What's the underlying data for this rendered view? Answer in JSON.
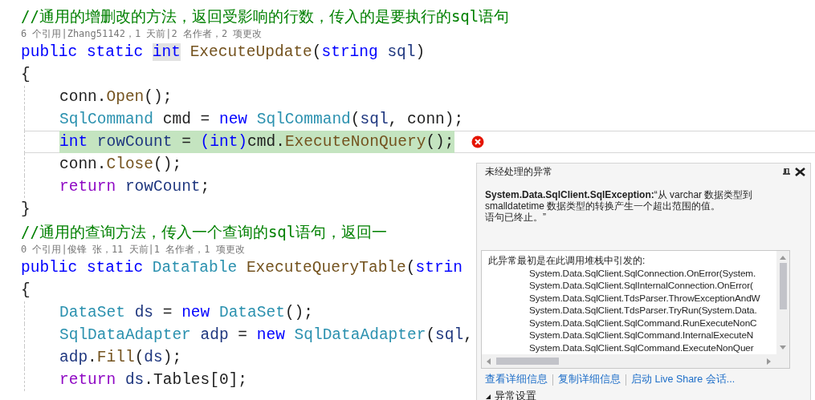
{
  "editor": {
    "lines": [
      {
        "kind": "comment",
        "text": "//通用的增删改的方法，返回受影响的行数，传入的是要执行的sql语句"
      },
      {
        "kind": "codelens",
        "text": "6 个引用|Zhang51142，1 天前|2 名作者，2 项更改"
      },
      {
        "kind": "code",
        "indented": false,
        "tokens": [
          {
            "text": "public ",
            "kind": "keyword"
          },
          {
            "text": "static ",
            "kind": "keyword"
          },
          {
            "text": "int",
            "kind": "keyword",
            "reference_highlight": true
          },
          {
            "text": " ExecuteUpdate",
            "kind": "method"
          },
          {
            "text": "(",
            "kind": "plain"
          },
          {
            "text": "string ",
            "kind": "keyword"
          },
          {
            "text": "sql",
            "kind": "local"
          },
          {
            "text": ")",
            "kind": "plain"
          }
        ]
      },
      {
        "kind": "code",
        "indented": false,
        "tokens": [
          {
            "text": "{",
            "kind": "plain"
          }
        ]
      },
      {
        "kind": "code",
        "indented": true,
        "tokens": [
          {
            "text": "conn.",
            "kind": "plain"
          },
          {
            "text": "Open",
            "kind": "method"
          },
          {
            "text": "();",
            "kind": "plain"
          }
        ]
      },
      {
        "kind": "code",
        "indented": true,
        "tokens": [
          {
            "text": "SqlCommand ",
            "kind": "type"
          },
          {
            "text": "cmd = ",
            "kind": "plain"
          },
          {
            "text": "new ",
            "kind": "keyword"
          },
          {
            "text": "SqlCommand",
            "kind": "type"
          },
          {
            "text": "(",
            "kind": "plain"
          },
          {
            "text": "sql",
            "kind": "local"
          },
          {
            "text": ", conn);",
            "kind": "plain"
          }
        ]
      },
      {
        "kind": "error_line",
        "indented": true,
        "tokens": [
          {
            "text": "int ",
            "kind": "keyword"
          },
          {
            "text": "rowCount",
            "kind": "local"
          },
          {
            "text": " = ",
            "kind": "plain"
          },
          {
            "text": "(int)",
            "kind": "keyword"
          },
          {
            "text": "cmd.",
            "kind": "plain"
          },
          {
            "text": "ExecuteNonQuery",
            "kind": "method"
          },
          {
            "text": "();",
            "kind": "plain"
          }
        ]
      },
      {
        "kind": "code",
        "indented": true,
        "tokens": [
          {
            "text": "conn.",
            "kind": "plain"
          },
          {
            "text": "Close",
            "kind": "method"
          },
          {
            "text": "();",
            "kind": "plain"
          }
        ]
      },
      {
        "kind": "code",
        "indented": true,
        "tokens": [
          {
            "text": "return ",
            "kind": "control"
          },
          {
            "text": "rowCount",
            "kind": "local"
          },
          {
            "text": ";",
            "kind": "plain"
          }
        ]
      },
      {
        "kind": "code",
        "indented": false,
        "tokens": [
          {
            "text": "}",
            "kind": "plain"
          }
        ]
      },
      {
        "kind": "comment",
        "text": "//通用的查询方法，传入一个查询的sql语句，返回一"
      },
      {
        "kind": "codelens",
        "text": "0 个引用|俊锋 张，11 天前|1 名作者，1 项更改"
      },
      {
        "kind": "code",
        "indented": false,
        "tokens": [
          {
            "text": "public ",
            "kind": "keyword"
          },
          {
            "text": "static ",
            "kind": "keyword"
          },
          {
            "text": "DataTable ",
            "kind": "type"
          },
          {
            "text": "ExecuteQueryTable",
            "kind": "method"
          },
          {
            "text": "(",
            "kind": "plain"
          },
          {
            "text": "strin",
            "kind": "keyword"
          }
        ]
      },
      {
        "kind": "code",
        "indented": false,
        "tokens": [
          {
            "text": "{",
            "kind": "plain"
          }
        ]
      },
      {
        "kind": "code",
        "indented": true,
        "tokens": [
          {
            "text": "DataSet ",
            "kind": "type"
          },
          {
            "text": "ds",
            "kind": "local"
          },
          {
            "text": " = ",
            "kind": "plain"
          },
          {
            "text": "new ",
            "kind": "keyword"
          },
          {
            "text": "DataSet",
            "kind": "type"
          },
          {
            "text": "();",
            "kind": "plain"
          }
        ]
      },
      {
        "kind": "code",
        "indented": true,
        "tokens": [
          {
            "text": "SqlDataAdapter ",
            "kind": "type"
          },
          {
            "text": "adp",
            "kind": "local"
          },
          {
            "text": " = ",
            "kind": "plain"
          },
          {
            "text": "new ",
            "kind": "keyword"
          },
          {
            "text": "SqlDataAdapter",
            "kind": "type"
          },
          {
            "text": "(",
            "kind": "plain"
          },
          {
            "text": "sql",
            "kind": "local"
          },
          {
            "text": ",",
            "kind": "plain"
          }
        ]
      },
      {
        "kind": "code",
        "indented": true,
        "tokens": [
          {
            "text": "adp",
            "kind": "local"
          },
          {
            "text": ".",
            "kind": "plain"
          },
          {
            "text": "Fill",
            "kind": "method"
          },
          {
            "text": "(",
            "kind": "plain"
          },
          {
            "text": "ds",
            "kind": "local"
          },
          {
            "text": ");",
            "kind": "plain"
          }
        ]
      },
      {
        "kind": "code",
        "indented": true,
        "tokens": [
          {
            "text": "return ",
            "kind": "control"
          },
          {
            "text": "ds",
            "kind": "local"
          },
          {
            "text": ".Tables[0];",
            "kind": "plain"
          }
        ]
      }
    ]
  },
  "exception_popup": {
    "title": "未经处理的异常",
    "message_lines": [
      "**System.Data.SqlClient.SqlException:**“从 varchar 数据类型到 smalldatetime 数据类型的转换产生一个超出范围的值。",
      "语句已终止。”"
    ],
    "stack_trace": {
      "heading": "此异常最初是在此调用堆栈中引发的:",
      "frames": [
        "System.Data.SqlClient.SqlConnection.OnError(System.",
        "System.Data.SqlClient.SqlInternalConnection.OnError(",
        "System.Data.SqlClient.TdsParser.ThrowExceptionAndW",
        "System.Data.SqlClient.TdsParser.TryRun(System.Data.",
        "System.Data.SqlClient.SqlCommand.RunExecuteNonC",
        "System.Data.SqlClient.SqlCommand.InternalExecuteN",
        "System.Data.SqlClient.SqlCommand.ExecuteNonQuer"
      ]
    },
    "links": [
      "查看详细信息",
      "复制详细信息",
      "启动 Live Share 会话..."
    ],
    "settings_toggle": "异常设置"
  }
}
